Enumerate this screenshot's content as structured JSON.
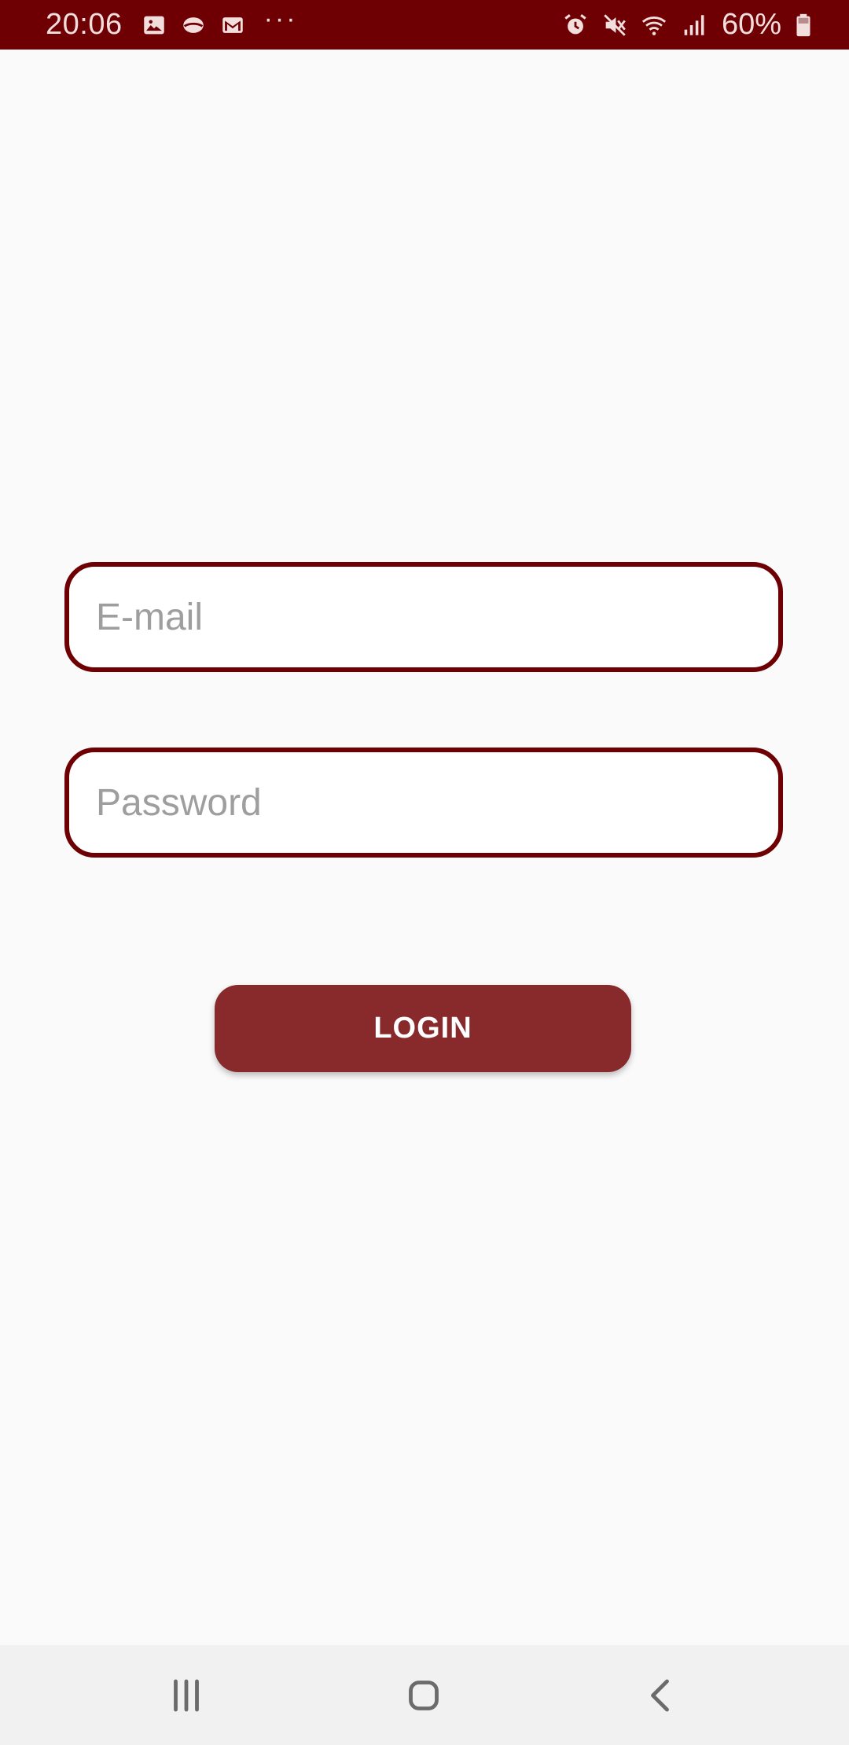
{
  "status_bar": {
    "time": "20:06",
    "left_icons": [
      "gallery-icon",
      "cloud-icon",
      "mail-icon"
    ],
    "more_indicator": "···",
    "right_icons": [
      "alarm-icon",
      "mute-icon",
      "wifi-icon",
      "signal-icon"
    ],
    "battery_text": "60%",
    "battery_icon": "battery-icon",
    "background_color": "#6e0003"
  },
  "form": {
    "email": {
      "placeholder": "E-mail",
      "value": ""
    },
    "password": {
      "placeholder": "Password",
      "value": ""
    },
    "login_label": "LOGIN",
    "accent_color": "#6e0003",
    "button_color": "#88292b"
  },
  "nav_bar": {
    "buttons": [
      "recents-icon",
      "home-icon",
      "back-icon"
    ]
  }
}
